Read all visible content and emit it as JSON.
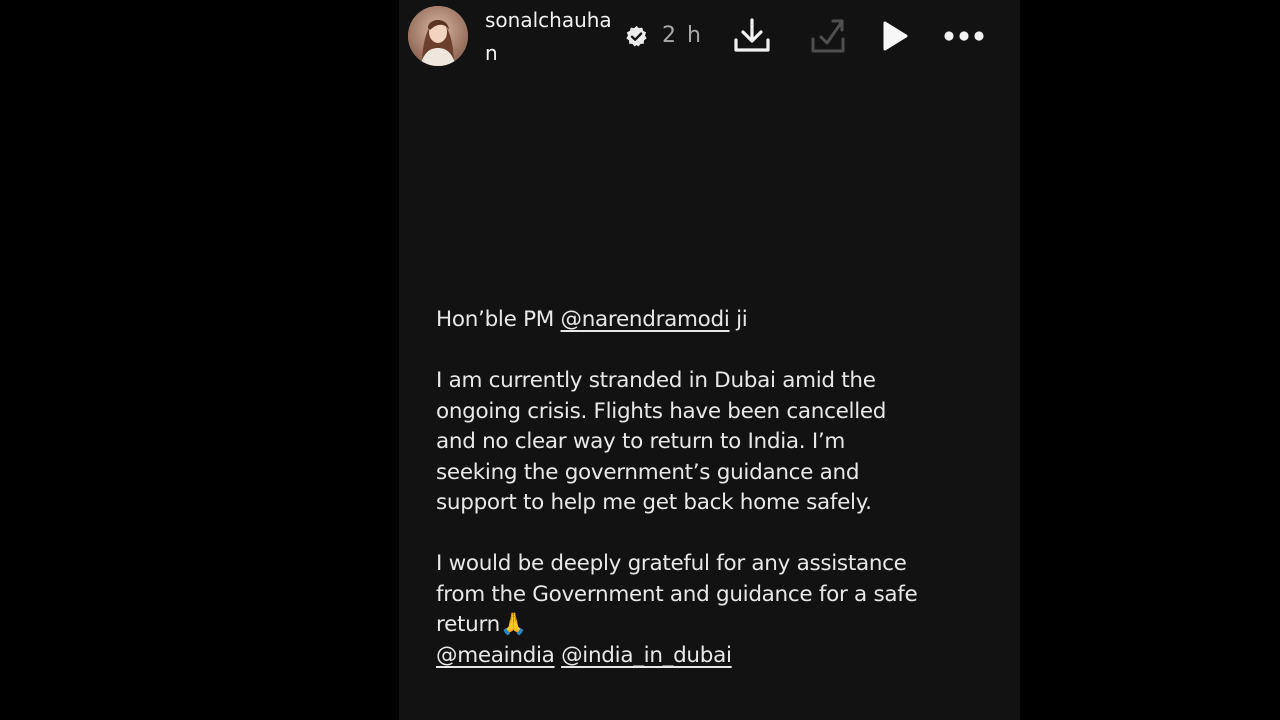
{
  "header": {
    "username": "sonalchauhan",
    "timestamp": "2 h",
    "verified_icon": "verified-badge-icon",
    "buttons": [
      {
        "name": "download-icon"
      },
      {
        "name": "save-to-collection-icon"
      },
      {
        "name": "play-icon"
      },
      {
        "name": "more-options-icon"
      }
    ]
  },
  "message": {
    "greeting_prefix": "Hon’ble PM",
    "greeting_mention": "@narendramodi",
    "greeting_suffix": "ji",
    "paragraph1_lines": [
      "I am currently stranded in Dubai amid the",
      "ongoing crisis. Flights have been cancelled",
      "and no clear way  to return to India. I’m",
      "seeking the government’s guidance and",
      "support to help me get back home safely."
    ],
    "paragraph2_lines": [
      "I would be deeply grateful for any assistance",
      "from the Government and guidance for a safe"
    ],
    "last_line_text": "return",
    "last_line_emoji": "🙏",
    "mentions": [
      "@meaindia",
      "@india_in_dubai"
    ]
  },
  "colors": {
    "page_background": "#000000",
    "story_background": "#121212",
    "text": "#e8e8e8",
    "muted_text": "#a9a9a9"
  }
}
